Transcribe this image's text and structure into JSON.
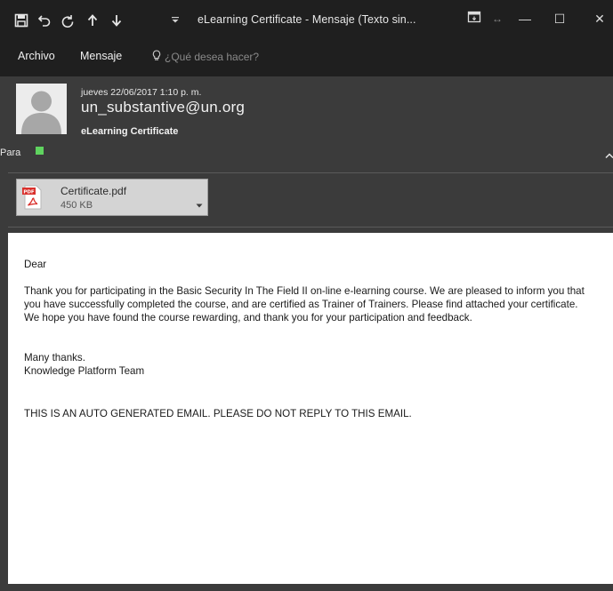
{
  "window": {
    "title": "eLearning Certificate  -  Mensaje (Texto sin...",
    "controls": {
      "minimize": "—",
      "maximize": "☐",
      "close": "✕"
    }
  },
  "quick_access": {
    "icons": [
      "save-icon",
      "undo-icon",
      "redo-icon",
      "previous-item-icon",
      "next-item-icon",
      "customize-toolbar-icon"
    ]
  },
  "menu": {
    "items": [
      "Archivo",
      "Mensaje"
    ],
    "tell_me_placeholder": "¿Qué desea hacer?"
  },
  "message": {
    "date": "jueves 22/06/2017 1:10 p. m.",
    "from": "un_substantive@un.org",
    "subject": "eLearning Certificate",
    "to_label": "Para",
    "to_status_color": "#5fd35f"
  },
  "attachment": {
    "icon_label": "PDF",
    "name": "Certificate.pdf",
    "size": "450 KB"
  },
  "body": {
    "greeting": "Dear",
    "paragraph": "Thank you for participating in the Basic Security In The Field II on-line e-learning course. We are pleased to inform you that you have successfully completed the course, and are certified as Trainer of Trainers. Please find attached your certificate. We hope you have found the course rewarding, and thank you for your participation and feedback.",
    "closing": "Many thanks.",
    "signature": "Knowledge Platform Team",
    "notice": "THIS IS AN AUTO GENERATED EMAIL. PLEASE DO NOT REPLY TO THIS EMAIL."
  },
  "colors": {
    "titlebar_bg": "#1f1f1f",
    "header_bg": "#3b3b3b",
    "body_bg": "#ffffff",
    "presence_green": "#5fd35f",
    "pdf_red": "#d9302c"
  }
}
